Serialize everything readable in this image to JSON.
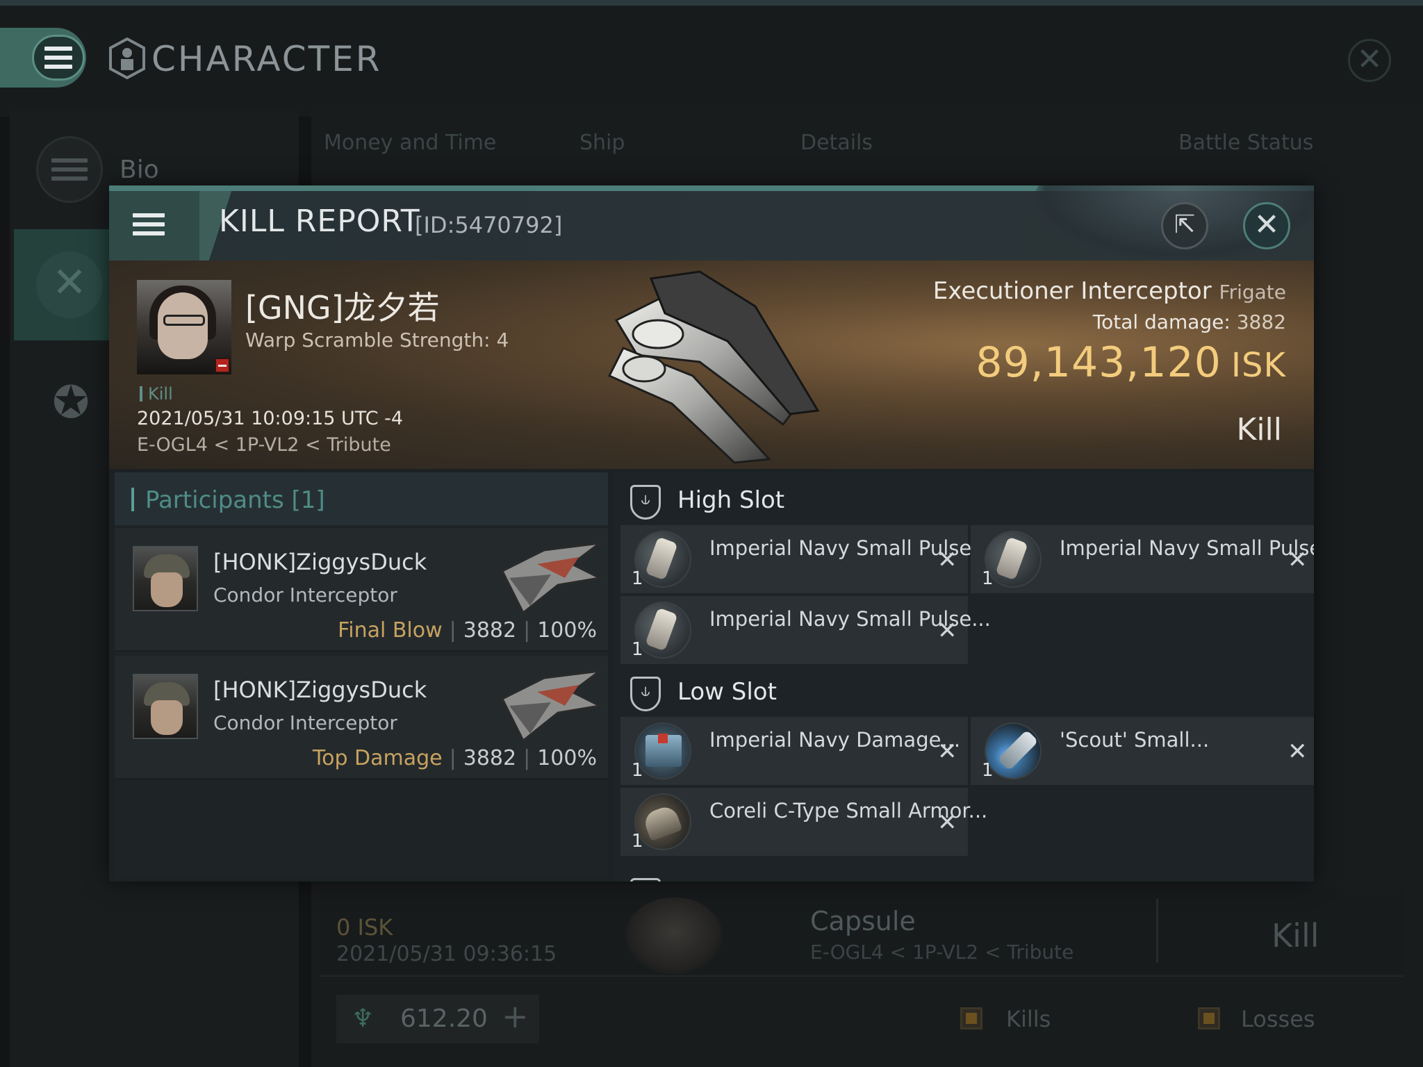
{
  "app": {
    "title": "CHARACTER"
  },
  "bg": {
    "sidebar": {
      "bio_label": "Bio"
    },
    "tabs": [
      "Money and Time",
      "Ship",
      "Details",
      "Battle Status"
    ],
    "row": {
      "isk": "0  ISK",
      "date": "2021/05/31  09:36:15",
      "ship": "Capsule",
      "location": "E-OGL4 < 1P-VL2 < Tribute",
      "result": "Kill"
    },
    "balance": "612.20",
    "filters": {
      "kills": "Kills",
      "losses": "Losses"
    }
  },
  "kill_report": {
    "title": "KILL REPORT",
    "id": "[ID:5470792]",
    "victim": {
      "name": "[GNG]龙夕若",
      "subtitle": "Warp Scramble Strength: 4",
      "tag": "Kill",
      "datetime": "2021/05/31 10:09:15 UTC -4",
      "location": "E-OGL4 < 1P-VL2 < Tribute"
    },
    "ship": {
      "name": "Executioner Interceptor",
      "class": "Frigate",
      "total_damage_label": "Total damage:",
      "total_damage": "3882",
      "isk_value": "89,143,120",
      "isk_unit": "ISK",
      "result": "Kill"
    },
    "participants": {
      "title": "Participants [1]",
      "rows": [
        {
          "name": "[HONK]ZiggysDuck",
          "ship": "Condor Interceptor",
          "tag": "Final Blow",
          "damage": "3882",
          "percent": "100%"
        },
        {
          "name": "[HONK]ZiggysDuck",
          "ship": "Condor Interceptor",
          "tag": "Top Damage",
          "damage": "3882",
          "percent": "100%"
        }
      ],
      "separator": "|"
    },
    "slots": {
      "high": {
        "title": "High Slot",
        "items": [
          {
            "name": "Imperial Navy Small Pulse...",
            "qty": "1",
            "icon": "pulse-laser-icon"
          },
          {
            "name": "Imperial Navy Small Pulse...",
            "qty": "1",
            "icon": "pulse-laser-icon"
          },
          {
            "name": "Imperial Navy Small Pulse...",
            "qty": "1",
            "icon": "pulse-laser-icon"
          }
        ]
      },
      "low": {
        "title": "Low Slot",
        "items": [
          {
            "name": "Imperial Navy Damage...",
            "qty": "1",
            "icon": "heat-sink-icon"
          },
          {
            "name": "'Scout' Small...",
            "qty": "1",
            "icon": "afterburner-icon"
          },
          {
            "name": "Coreli C-Type Small Armor...",
            "qty": "1",
            "icon": "armor-repairer-icon"
          }
        ]
      }
    }
  },
  "colors": {
    "accent": "#4c7d79",
    "isk": "#f3cc7d",
    "tag_gold": "#c7a360",
    "badge_red": "#b3241e"
  }
}
